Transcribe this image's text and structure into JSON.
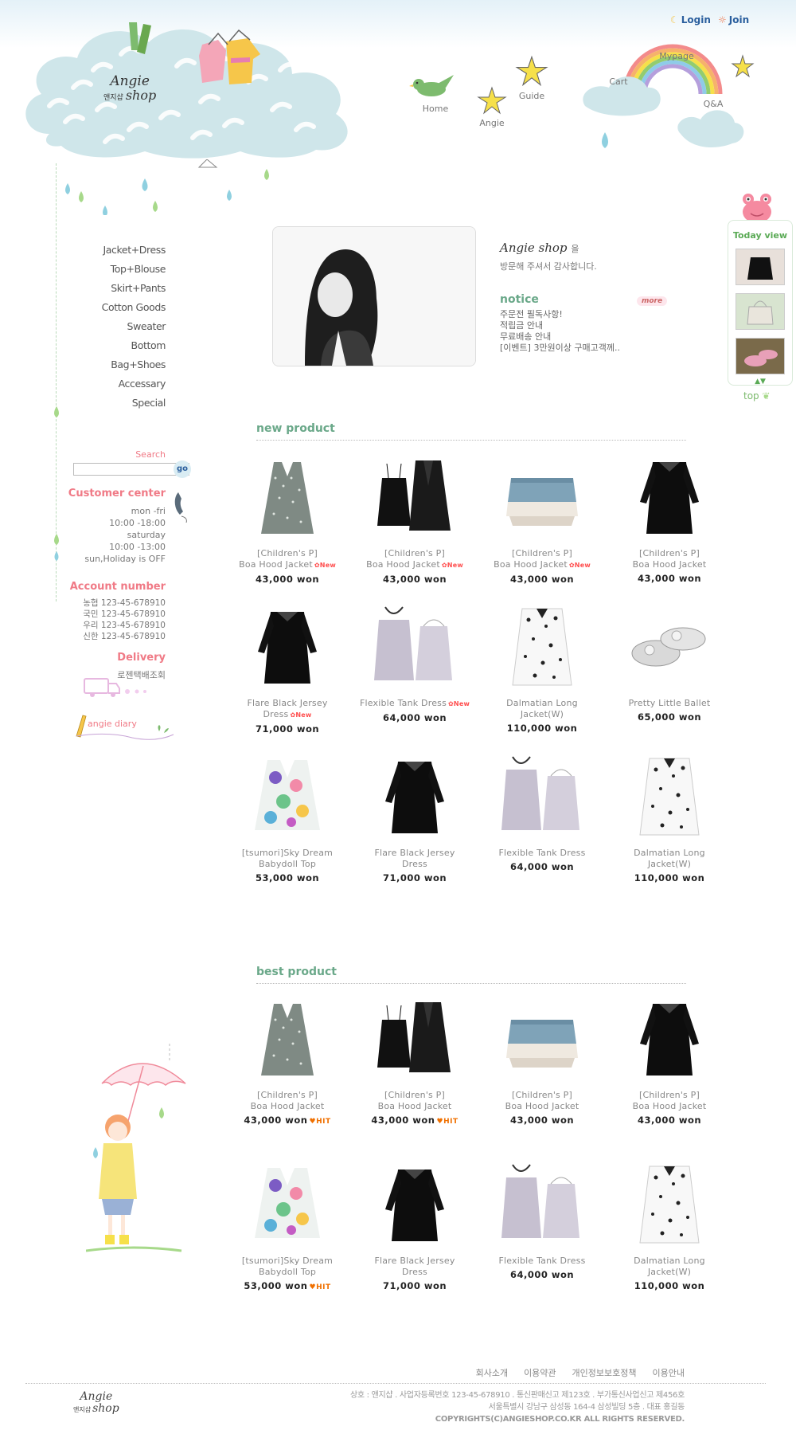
{
  "header": {
    "logo_line1": "Angie",
    "logo_small": "앤지샵",
    "logo_line2": "shop",
    "login_label": "Login",
    "join_label": "Join",
    "nav": {
      "home": "Home",
      "angie": "Angie",
      "guide": "Guide",
      "cart": "Cart",
      "mypage": "Mypage",
      "qna": "Q&A"
    }
  },
  "sidebar": {
    "categories": [
      "Jacket+Dress",
      "Top+Blouse",
      "Skirt+Pants",
      "Cotton Goods",
      "Sweater",
      "Bottom",
      "Bag+Shoes",
      "Accessary",
      "Special"
    ],
    "search_label": "Search",
    "search_value": "",
    "go_label": "go",
    "customer_center": {
      "title": "Customer center",
      "lines": [
        "mon -fri",
        "10:00 -18:00",
        "saturday",
        "10:00 -13:00",
        "sun,Holiday is OFF"
      ]
    },
    "account": {
      "title": "Account number",
      "lines": [
        "농협  123-45-678910",
        "국민  123-45-678910",
        "우리  123-45-678910",
        "신한  123-45-678910"
      ]
    },
    "delivery": {
      "title": "Delivery",
      "text": "로젠택배조회"
    },
    "diary_label": "angie diary"
  },
  "welcome": {
    "brand": "Angie shop",
    "suffix": "을",
    "line2": "방문해 주셔서 감사합니다.",
    "notice_title": "notice",
    "more_label": "more",
    "notices": [
      "주문전 필독사항!",
      "적립금 안내",
      "무료배송 안내",
      "[이벤트] 3만원이상 구매고객께.."
    ]
  },
  "today_view": {
    "title": "Today view",
    "top_label": "top"
  },
  "new_product": {
    "title": "new product",
    "rows": [
      [
        {
          "name1": "[Children's P]",
          "name2": "Boa Hood Jacket",
          "badge": "New",
          "price": "43,000 won",
          "img": "dots-dress"
        },
        {
          "name1": "[Children's P]",
          "name2": "Boa Hood Jacket",
          "badge": "New",
          "price": "43,000 won",
          "img": "black-set"
        },
        {
          "name1": "[Children's P]",
          "name2": "Boa Hood Jacket",
          "badge": "New",
          "price": "43,000 won",
          "img": "denim-skirt"
        },
        {
          "name1": "[Children's P]",
          "name2": "Boa Hood Jacket",
          "badge": "",
          "price": "43,000 won",
          "img": "black-dress"
        }
      ],
      [
        {
          "name1": "Flare Black Jersey",
          "name2": "Dress",
          "badge": "New",
          "price": "71,000 won",
          "img": "black-dress"
        },
        {
          "name1": "Flexible Tank Dress",
          "name2": "",
          "badge": "New",
          "price": "64,000 won",
          "img": "tank-dress"
        },
        {
          "name1": "Dalmatian Long",
          "name2": "Jacket(W)",
          "badge": "",
          "price": "110,000 won",
          "img": "dalmatian"
        },
        {
          "name1": "Pretty Little Ballet",
          "name2": "",
          "badge": "",
          "price": "65,000 won",
          "img": "shoes"
        }
      ],
      [
        {
          "name1": "[tsumori]Sky Dream",
          "name2": "Babydoll Top",
          "badge": "",
          "price": "53,000 won",
          "img": "floral"
        },
        {
          "name1": "Flare Black Jersey",
          "name2": "Dress",
          "badge": "",
          "price": "71,000 won",
          "img": "black-dress"
        },
        {
          "name1": "Flexible Tank Dress",
          "name2": "",
          "badge": "",
          "price": "64,000 won",
          "img": "tank-dress"
        },
        {
          "name1": "Dalmatian Long",
          "name2": "Jacket(W)",
          "badge": "",
          "price": "110,000 won",
          "img": "dalmatian"
        }
      ]
    ]
  },
  "best_product": {
    "title": "best product",
    "rows": [
      [
        {
          "name1": "[Children's P]",
          "name2": "Boa Hood Jacket",
          "badge": "",
          "price": "43,000 won",
          "hit": "Hit",
          "img": "dots-dress"
        },
        {
          "name1": "[Children's P]",
          "name2": "Boa Hood Jacket",
          "badge": "",
          "price": "43,000 won",
          "hit": "Hit",
          "img": "black-set"
        },
        {
          "name1": "[Children's P]",
          "name2": "Boa Hood Jacket",
          "badge": "",
          "price": "43,000 won",
          "hit": "",
          "img": "denim-skirt"
        },
        {
          "name1": "[Children's P]",
          "name2": "Boa Hood Jacket",
          "badge": "",
          "price": "43,000 won",
          "hit": "",
          "img": "black-dress"
        }
      ],
      [
        {
          "name1": "[tsumori]Sky Dream",
          "name2": "Babydoll Top",
          "badge": "",
          "price": "53,000 won",
          "hit": "Hit",
          "img": "floral"
        },
        {
          "name1": "Flare Black Jersey",
          "name2": "Dress",
          "badge": "",
          "price": "71,000 won",
          "hit": "",
          "img": "black-dress"
        },
        {
          "name1": "Flexible Tank Dress",
          "name2": "",
          "badge": "",
          "price": "64,000 won",
          "hit": "",
          "img": "tank-dress"
        },
        {
          "name1": "Dalmatian Long",
          "name2": "Jacket(W)",
          "badge": "",
          "price": "110,000 won",
          "hit": "",
          "img": "dalmatian"
        }
      ]
    ]
  },
  "footer": {
    "links": [
      "회사소개",
      "이용약관",
      "개인정보보호정책",
      "이용안내"
    ],
    "line1": "상호 : 앤지샵 . 사업자등록번호 123-45-678910 . 통신판매신고 제123호 . 부가통신사업신고 제456호",
    "line2": "서울특별시 강남구 삼성동 164-4 삼성빌딩 5층 . 대표 홍길동",
    "line3": "COPYRIGHTS(C)ANGIESHOP.CO.KR ALL RIGHTS RESERVED."
  },
  "colors": {
    "accent_pink": "#f07a86",
    "accent_green": "#6aa889",
    "link_blue": "#2b5f9e",
    "cloud": "#cfe6ea"
  }
}
